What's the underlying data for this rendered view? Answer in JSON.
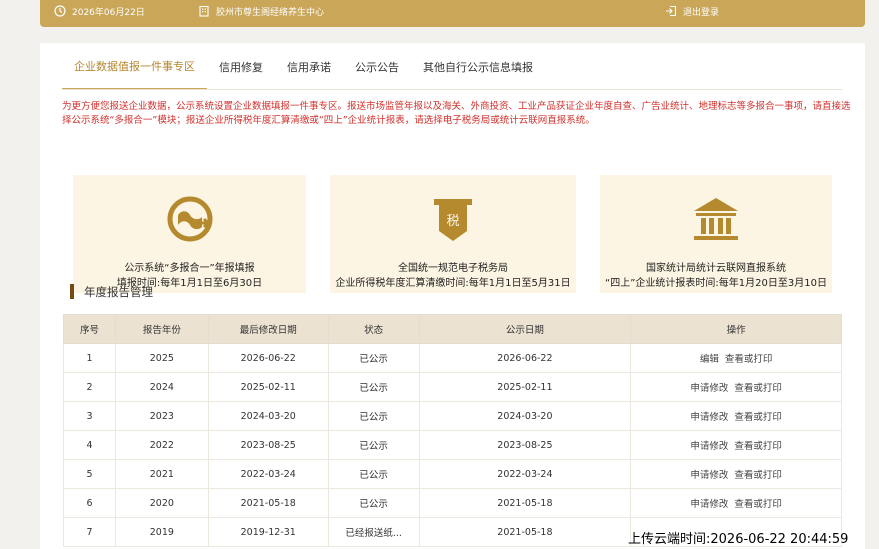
{
  "topbar": {
    "date": "2026年06月22日",
    "company": "胶州市尊生阁经络养生中心",
    "logout": "退出登录",
    "icons": {
      "date": "clock-icon",
      "company": "building-icon",
      "logout": "logout-icon"
    }
  },
  "tabs": [
    {
      "label": "企业数据值报一件事专区",
      "active": true
    },
    {
      "label": "信用修复"
    },
    {
      "label": "信用承诺"
    },
    {
      "label": "公示公告"
    },
    {
      "label": "其他自行公示信息填报"
    }
  ],
  "notice": "为更方便您报送企业数据，公示系统设置企业数据填报一件事专区。报送市场监管年报以及海关、外商投资、工业产品获证企业年度自查、广告业统计、地理标志等多报合一事项，请直接选择公示系统“多报合一”模块；报送企业所得税年度汇算清缴或“四上”企业统计报表，请选择电子税务局或统计云联网直报系统。",
  "cards": [
    {
      "icon": "report-combine-icon",
      "line1": "公示系统“多报合一”年报填报",
      "line2": "填报时间:每年1月1日至6月30日"
    },
    {
      "icon": "tax-icon",
      "line1": "全国统一规范电子税务局",
      "line2": "企业所得税年度汇算清缴时间:每年1月1日至5月31日"
    },
    {
      "icon": "bank-building-icon",
      "line1": "国家统计局统计云联网直报系统",
      "line2": "“四上”企业统计报表时间:每年1月20日至3月10日"
    }
  ],
  "section_title": "年度报告管理",
  "table": {
    "headers": [
      "序号",
      "报告年份",
      "最后修改日期",
      "状态",
      "公示日期",
      "操作"
    ],
    "rows": [
      {
        "no": "1",
        "year": "2025",
        "modified": "2026-06-22",
        "status": "已公示",
        "published": "2026-06-22",
        "action1": "编辑",
        "action2": "查看或打印"
      },
      {
        "no": "2",
        "year": "2024",
        "modified": "2025-02-11",
        "status": "已公示",
        "published": "2025-02-11",
        "action1": "申请修改",
        "action2": "查看或打印"
      },
      {
        "no": "3",
        "year": "2023",
        "modified": "2024-03-20",
        "status": "已公示",
        "published": "2024-03-20",
        "action1": "申请修改",
        "action2": "查看或打印"
      },
      {
        "no": "4",
        "year": "2022",
        "modified": "2023-08-25",
        "status": "已公示",
        "published": "2023-08-25",
        "action1": "申请修改",
        "action2": "查看或打印"
      },
      {
        "no": "5",
        "year": "2021",
        "modified": "2022-03-24",
        "status": "已公示",
        "published": "2022-03-24",
        "action1": "申请修改",
        "action2": "查看或打印"
      },
      {
        "no": "6",
        "year": "2020",
        "modified": "2021-05-18",
        "status": "已公示",
        "published": "2021-05-18",
        "action1": "申请修改",
        "action2": "查看或打印"
      },
      {
        "no": "7",
        "year": "2019",
        "modified": "2019-12-31",
        "status": "已经报送纸...",
        "published": "2021-05-18",
        "action1": "",
        "action2": ""
      }
    ]
  },
  "watermark": "上传云端时间:2026-06-22 20:44:59",
  "colors": {
    "gold": "#c9a658",
    "card_bg": "#fdf5e3",
    "notice_red": "#d0312d",
    "header_bg": "#ebe2d2",
    "section_bar": "#7a4a14"
  }
}
